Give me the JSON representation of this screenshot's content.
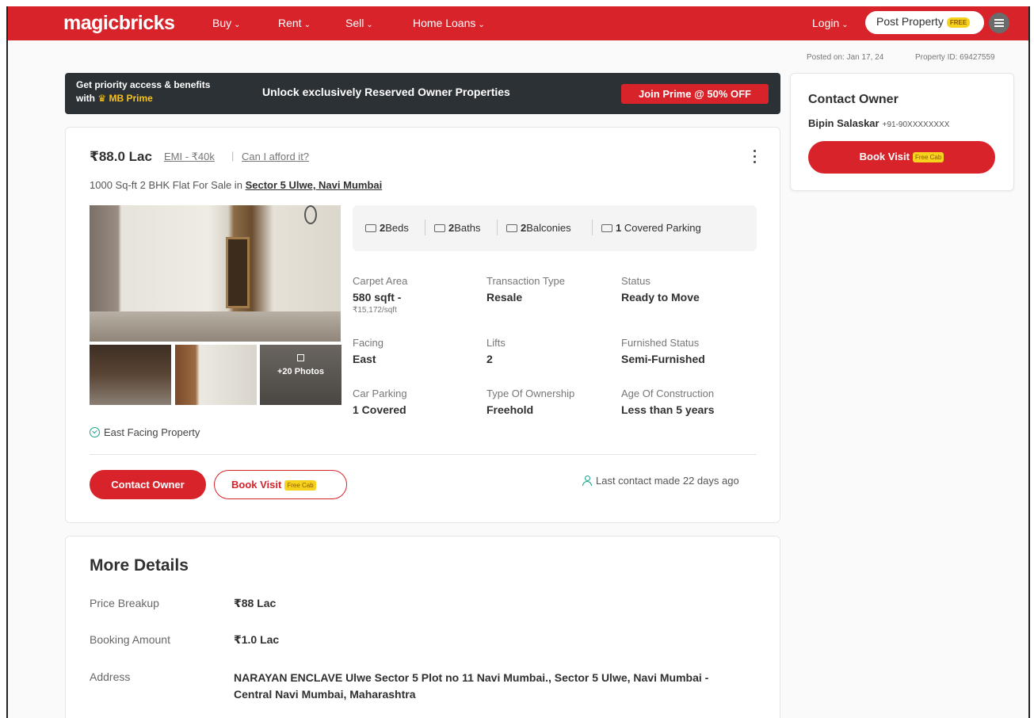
{
  "header": {
    "logo": "magicbricks",
    "nav": [
      {
        "label": "Buy"
      },
      {
        "label": "Rent"
      },
      {
        "label": "Sell"
      },
      {
        "label": "Home Loans"
      }
    ],
    "login": "Login",
    "post_property": "Post Property",
    "free_tag": "FREE"
  },
  "meta": {
    "posted_on": "Posted on: Jan 17, 24",
    "property_id": "Property ID: 69427559"
  },
  "prime_banner": {
    "line1": "Get priority access & benefits",
    "line2_prefix": "with",
    "line2_brand": "MB Prime",
    "middle": "Unlock exclusively Reserved Owner Properties",
    "button": "Join Prime @ 50% OFF"
  },
  "listing": {
    "price": "₹88.0 Lac",
    "emi": "EMI - ₹40k",
    "separator": "|",
    "afford": "Can I afford it?",
    "subtitle": "1000 Sq-ft 2 BHK Flat For Sale in",
    "locality": "Sector 5 Ulwe, Navi Mumbai",
    "photo_count": "+20 Photos",
    "highlight": "East Facing Property",
    "amenities": [
      {
        "value": "2",
        "label": "Beds",
        "icon": "bed-icon"
      },
      {
        "value": "2",
        "label": "Baths",
        "icon": "bath-icon"
      },
      {
        "value": "2",
        "label": "Balconies",
        "icon": "balcony-icon"
      },
      {
        "value": "1",
        "label": "Covered Parking",
        "icon": "parking-icon"
      }
    ],
    "facts": [
      {
        "label": "Carpet Area",
        "value": "580 sqft -",
        "sub": "₹15,172/sqft"
      },
      {
        "label": "Transaction Type",
        "value": "Resale"
      },
      {
        "label": "Status",
        "value": "Ready to Move"
      },
      {
        "label": "Facing",
        "value": "East"
      },
      {
        "label": "Lifts",
        "value": "2"
      },
      {
        "label": "Furnished Status",
        "value": "Semi-Furnished"
      },
      {
        "label": "Car Parking",
        "value": "1 Covered"
      },
      {
        "label": "Type Of Ownership",
        "value": "Freehold"
      },
      {
        "label": "Age Of Construction",
        "value": "Less than 5 years"
      }
    ],
    "contact_button": "Contact Owner",
    "visit_button": "Book Visit",
    "free_cab": "Free Cab",
    "last_contact": "Last contact made 22 days ago"
  },
  "sidebar": {
    "title": "Contact Owner",
    "owner_name": "Bipin Salaskar",
    "owner_phone": "+91-90XXXXXXXX",
    "button": "Book Visit",
    "free_cab": "Free Cab"
  },
  "more_details": {
    "title": "More Details",
    "rows": [
      {
        "label": "Price Breakup",
        "value": "₹88 Lac"
      },
      {
        "label": "Booking Amount",
        "value": "₹1.0 Lac"
      },
      {
        "label": "Address",
        "value": "NARAYAN ENCLAVE Ulwe Sector 5 Plot no 11 Navi Mumbai., Sector 5 Ulwe, Navi Mumbai - Central Navi Mumbai, Maharashtra"
      }
    ]
  },
  "colors": {
    "brand_red": "#d8232a",
    "banner_dark": "#2c3135",
    "prime_gold": "#f7c21c",
    "accent_green": "#19a38b"
  }
}
